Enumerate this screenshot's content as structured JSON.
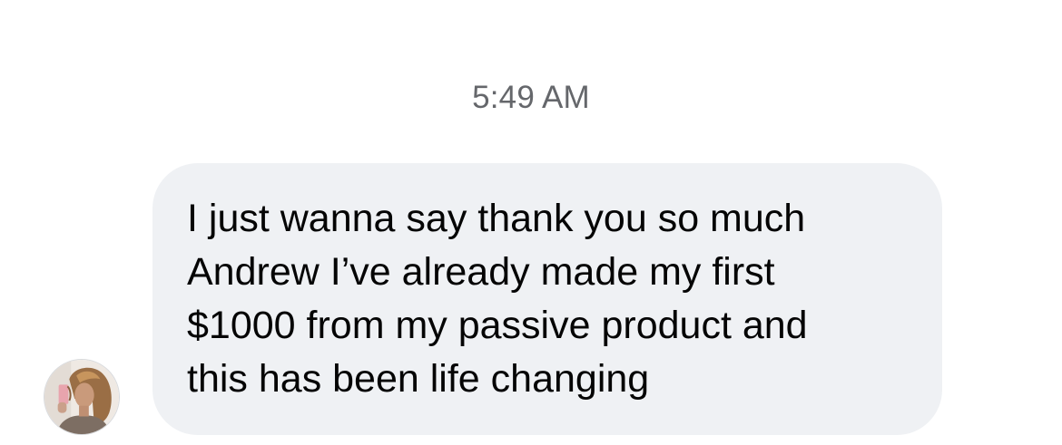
{
  "conversation": {
    "timestamp": "5:49 AM",
    "messages": [
      {
        "sender": "received",
        "text": "I just wanna say thank you so much\nAndrew I’ve already made my first\n$1000 from my passive product and\nthis has been life changing"
      }
    ]
  },
  "colors": {
    "background": "#ffffff",
    "bubble": "#eff1f4",
    "message_text": "#050505",
    "timestamp_text": "#65676b"
  },
  "icons": {
    "avatar": "profile-photo-avatar"
  }
}
